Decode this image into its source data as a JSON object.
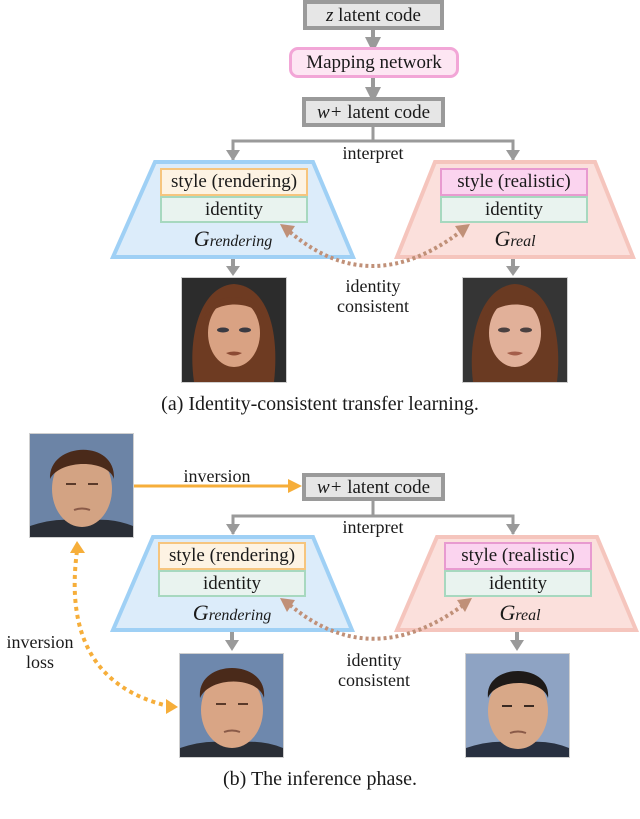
{
  "figure": {
    "part_a": {
      "z_latent": {
        "var": "z",
        "text": " latent code"
      },
      "mapping_network": "Mapping network",
      "w_latent": {
        "var": "w+",
        "text": " latent code"
      },
      "interpret_label": "interpret",
      "generator_rendering": {
        "style": "style (rendering)",
        "identity": "identity",
        "name": {
          "main": "G",
          "sub": "rendering"
        },
        "color": "#9fd0f5",
        "fill": "#dcecfa"
      },
      "generator_real": {
        "style": "style (realistic)",
        "identity": "identity",
        "name": {
          "main": "G",
          "sub": "real"
        },
        "color": "#f5c5bd",
        "fill": "#fbe0dc"
      },
      "identity_link_label": [
        "identity",
        "consistent"
      ],
      "images": [
        {
          "desc": "rendered female face",
          "hair": "#6e3b22",
          "skin": "#d9a283",
          "bg": "#2c2c2c"
        },
        {
          "desc": "realistic female face",
          "hair": "#6a3a22",
          "skin": "#e1b099",
          "bg": "#353535"
        }
      ],
      "caption": "(a) Identity-consistent transfer learning."
    },
    "part_b": {
      "inversion_label": "inversion",
      "w_latent": {
        "var": "w+",
        "text": " latent code"
      },
      "interpret_label": "interpret",
      "generator_rendering": {
        "style": "style (rendering)",
        "identity": "identity",
        "name": {
          "main": "G",
          "sub": "rendering"
        }
      },
      "generator_real": {
        "style": "style (realistic)",
        "identity": "identity",
        "name": {
          "main": "G",
          "sub": "real"
        }
      },
      "identity_link_label": [
        "identity",
        "consistent"
      ],
      "inversion_loss_label": [
        "inversion",
        "loss"
      ],
      "images": [
        {
          "desc": "input rendered male face",
          "hair": "#4a2a1a",
          "skin": "#d3a383",
          "bg": "#6c84a6"
        },
        {
          "desc": "reconstructed rendered male face",
          "hair": "#4a2a1a",
          "skin": "#d9a585",
          "bg": "#6e88ad"
        },
        {
          "desc": "realistic male face",
          "hair": "#1e1a18",
          "skin": "#d8a888",
          "bg": "#8ea3c3"
        }
      ],
      "caption": "(b) The inference phase."
    },
    "colors": {
      "wire": "#9a9a9a",
      "identity_arrow": "#c09078",
      "inversion_arrow": "#f6ae3a"
    }
  }
}
